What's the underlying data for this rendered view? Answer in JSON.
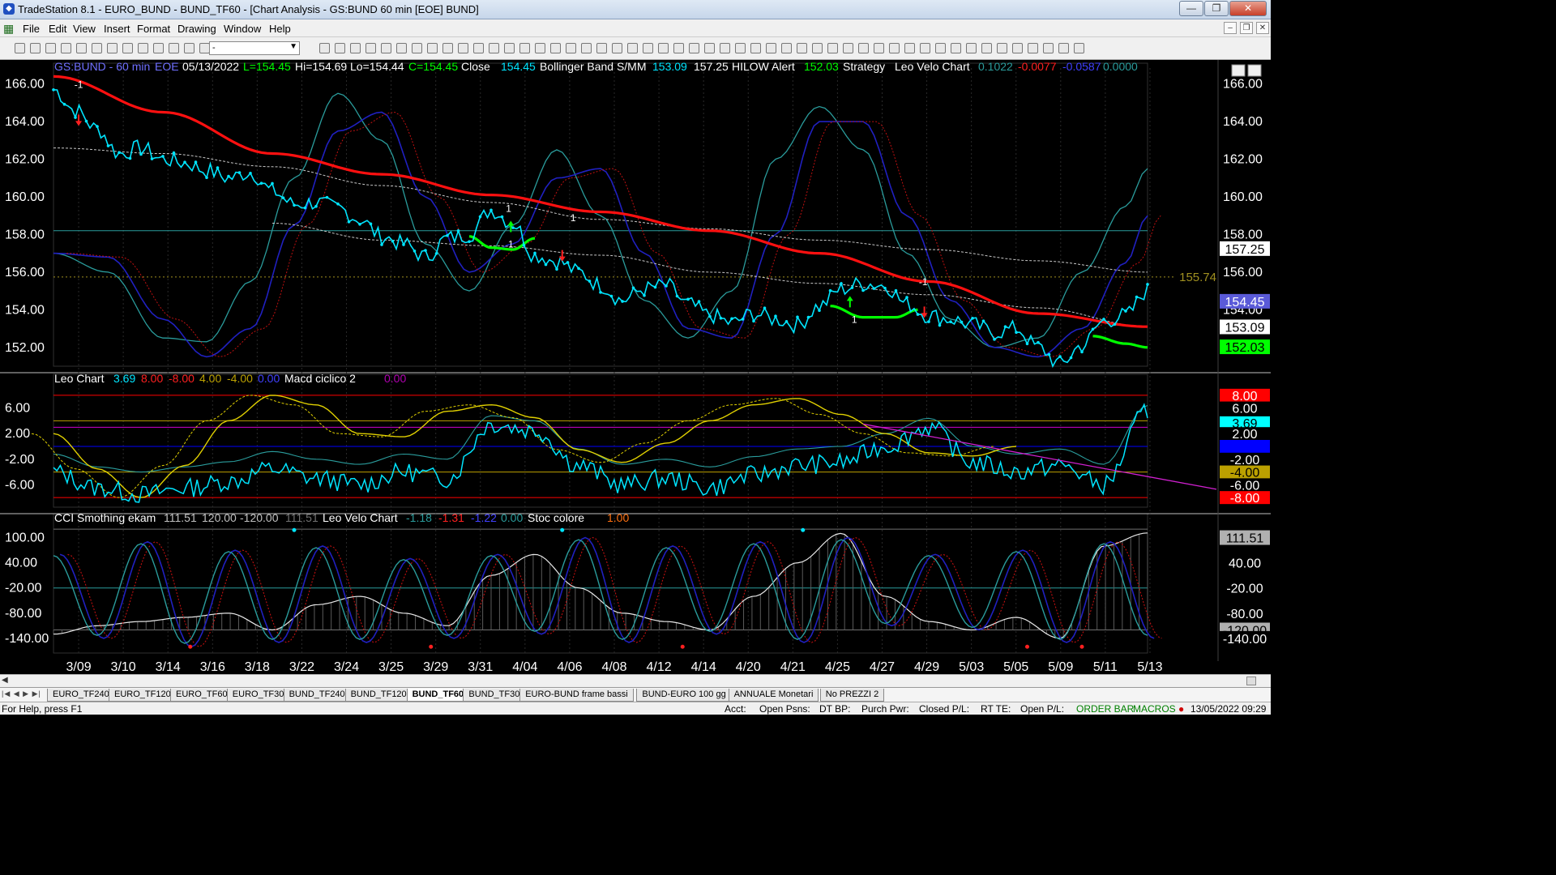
{
  "window": {
    "title": "TradeStation 8.1 - EURO_BUND - BUND_TF60 - [Chart Analysis - GS:BUND  60 min  [EOE] BUND]"
  },
  "menu": [
    "File",
    "Edit",
    "View",
    "Insert",
    "Format",
    "Drawing",
    "Window",
    "Help"
  ],
  "toolbar": {
    "combo_value": "-"
  },
  "chart_data": [
    {
      "type": "line",
      "panel": "price",
      "header": {
        "symbol": "GS:BUND - 60 min",
        "session": "EOE",
        "date": "05/13/2022",
        "last": "L=154.45",
        "high": "Hi=154.69",
        "low": "Lo=154.44",
        "close_c": "C=154.45",
        "close_label": "Close",
        "close_value": "154.45",
        "bb_label": "Bollinger Band S/MM",
        "bb_low": "153.09",
        "bb_high": "157.25",
        "hilow_label": "HILOW Alert",
        "hilow_value": "152.03",
        "strategy_label": "Strategy",
        "velo_label": "Leo Velo Chart",
        "velo_v1": "0.1022",
        "velo_v2": "-0.0077",
        "velo_v3": "-0.0587",
        "velo_v4": "0.0000"
      },
      "ylim": [
        151.0,
        166.5
      ],
      "y_ticks": [
        "166.00",
        "164.00",
        "162.00",
        "160.00",
        "158.00",
        "156.00",
        "154.00",
        "152.00"
      ],
      "right_labels": [
        {
          "text": "157.25",
          "value": 157.25,
          "bg": "#ffffff",
          "fg": "#000000"
        },
        {
          "text": "154.45",
          "value": 154.45,
          "bg": "#5a5ad8",
          "fg": "#ffffff"
        },
        {
          "text": "153.09",
          "value": 153.09,
          "bg": "#ffffff",
          "fg": "#000000"
        },
        {
          "text": "152.03",
          "value": 152.03,
          "bg": "#00ff00",
          "fg": "#000000"
        }
      ],
      "ref_line": {
        "text": "155.74",
        "value": 155.74,
        "color": "#a09020"
      },
      "hline": 158.2,
      "close_x": [
        0,
        2,
        4,
        6,
        8,
        10,
        12,
        14,
        16,
        18,
        20,
        22,
        24,
        26,
        28,
        30,
        32,
        34,
        36,
        38,
        40,
        42,
        44,
        46,
        48,
        50,
        52,
        54,
        56,
        58,
        60,
        62,
        64,
        66,
        68,
        70,
        72,
        74,
        76,
        78,
        80,
        82,
        84,
        86,
        88,
        90,
        92,
        94,
        96,
        98,
        100
      ],
      "close": [
        165.7,
        164.6,
        163.6,
        162.3,
        162.6,
        162.0,
        161.8,
        161.4,
        161.0,
        161.3,
        160.3,
        159.6,
        159.7,
        159.4,
        158.8,
        157.9,
        157.5,
        156.8,
        157.8,
        158.0,
        159.3,
        158.6,
        156.9,
        156.6,
        156.0,
        155.3,
        154.5,
        155.1,
        155.3,
        154.3,
        153.7,
        153.3,
        153.8,
        153.5,
        153.2,
        154.2,
        155.1,
        155.4,
        155.3,
        154.3,
        153.7,
        153.5,
        153.2,
        152.8,
        153.0,
        152.0,
        151.1,
        152.1,
        153.4,
        153.7,
        155.0
      ],
      "sma_x": [
        0,
        10,
        20,
        30,
        40,
        50,
        60,
        70,
        80,
        90,
        100
      ],
      "sma": [
        166.4,
        164.5,
        162.3,
        161.2,
        160.1,
        159.2,
        158.2,
        157.0,
        155.5,
        153.8,
        153.1
      ],
      "bb_upper": [
        162.6,
        162.3,
        161.6,
        160.6,
        159.7,
        158.8,
        158.3,
        157.7,
        157.2,
        156.6,
        156.0
      ],
      "bb_upper_tail": [
        162.3,
        161.9,
        161.1,
        160.2,
        159.3,
        158.7,
        157.8,
        157.2
      ],
      "bb_lower_x": [
        20,
        30,
        40,
        50,
        60,
        70,
        80,
        90,
        100
      ],
      "bb_lower": [
        158.6,
        157.7,
        157.4,
        156.9,
        156.0,
        155.4,
        154.8,
        154.1,
        153.1
      ],
      "osc_x": [
        0,
        5,
        10,
        14,
        18,
        22,
        26,
        30,
        34,
        38,
        42,
        46,
        50,
        54,
        58,
        62,
        66,
        70,
        74,
        78,
        82,
        86,
        90,
        94,
        98,
        100
      ],
      "osc_teal": [
        157.0,
        156.0,
        152.5,
        152.3,
        155.5,
        161.0,
        165.5,
        163.0,
        157.5,
        155.0,
        158.5,
        162.5,
        159.0,
        154.5,
        152.5,
        155.0,
        162.0,
        164.8,
        162.5,
        157.0,
        153.5,
        152.0,
        152.5,
        156.0,
        159.5,
        161.5
      ],
      "osc_blue": [
        157.0,
        156.8,
        153.5,
        151.5,
        153.0,
        158.5,
        163.5,
        164.5,
        160.0,
        156.0,
        157.5,
        161.0,
        161.5,
        157.0,
        153.0,
        152.5,
        158.0,
        164.0,
        164.0,
        159.0,
        154.5,
        152.0,
        151.5,
        153.0,
        156.5,
        159.0
      ]
    },
    {
      "type": "line",
      "panel": "leo_chart",
      "header": {
        "title": "Leo Chart",
        "v1": "3.69",
        "v2": "8.00",
        "v3": "-8.00",
        "v4": "4.00",
        "v5": "-4.00",
        "v6": "0.00",
        "macd_label": "Macd ciclico 2",
        "macd_value": "0.00"
      },
      "ylim": [
        -9.5,
        9.5
      ],
      "y_ticks": [
        "6.00",
        "2.00",
        "-2.00",
        "-6.00"
      ],
      "right_labels": [
        {
          "text": "8.00",
          "value": 8.0,
          "bg": "#ff0000",
          "fg": "#ffffff"
        },
        {
          "text": "6.00",
          "value": 6.0,
          "bg": "#000000",
          "fg": "#ffffff"
        },
        {
          "text": "3.69",
          "value": 3.69,
          "bg": "#00ffff",
          "fg": "#000000"
        },
        {
          "text": "2.00",
          "value": 2.0,
          "bg": "#000000",
          "fg": "#ffffff"
        },
        {
          "text": "0.00",
          "value": 0.0,
          "bg": "#0000ff",
          "fg": "#0000ff"
        },
        {
          "text": "-2.00",
          "value": -2.0,
          "bg": "#000000",
          "fg": "#ffffff"
        },
        {
          "text": "-4.00",
          "value": -4.0,
          "bg": "#bba000",
          "fg": "#000000"
        },
        {
          "text": "-6.00",
          "value": -6.0,
          "bg": "#000000",
          "fg": "#ffffff"
        },
        {
          "text": "-8.00",
          "value": -8.0,
          "bg": "#ff0000",
          "fg": "#ffffff"
        }
      ],
      "levels": [
        {
          "value": 8.0,
          "color": "#ff0000"
        },
        {
          "value": 4.0,
          "color": "#bba000"
        },
        {
          "value": 3.0,
          "color": "#cc00cc"
        },
        {
          "value": 0.0,
          "color": "#0000ff"
        },
        {
          "value": -4.0,
          "color": "#bba000"
        },
        {
          "value": -8.0,
          "color": "#ff0000"
        }
      ],
      "x": [
        0,
        4,
        8,
        12,
        16,
        20,
        24,
        28,
        32,
        36,
        40,
        44,
        48,
        52,
        56,
        60,
        64,
        68,
        72,
        76,
        80,
        84,
        88,
        92,
        96,
        100
      ],
      "leo": [
        -4.0,
        -6.5,
        -7.5,
        -6.5,
        -5.5,
        -3.5,
        -5.0,
        -6.0,
        -4.0,
        -5.0,
        3.5,
        2.5,
        -3.0,
        -6.0,
        -5.0,
        -6.5,
        -4.5,
        -3.0,
        -2.5,
        0.0,
        3.0,
        -2.5,
        -4.0,
        -3.0,
        -6.0,
        5.5
      ],
      "yellow": [
        2.0,
        -3.5,
        -8.0,
        -3.0,
        4.0,
        8.0,
        6.5,
        2.0,
        1.5,
        5.5,
        6.5,
        4.5,
        -0.5,
        -2.5,
        0.5,
        4.0,
        6.5,
        7.5,
        5.0,
        2.0,
        -1.0,
        -1.5,
        0.0
      ],
      "yellow_x": [
        0,
        4,
        8,
        12,
        16,
        20,
        24,
        28,
        32,
        36,
        40,
        44,
        48,
        52,
        56,
        60,
        64,
        68,
        72,
        76,
        80,
        84,
        88
      ],
      "trend_x": [
        74,
        100
      ],
      "trend": [
        3.5,
        -5.5
      ]
    },
    {
      "type": "line",
      "panel": "cci",
      "header": {
        "title": "CCI Smothing ekam",
        "v1": "111.51",
        "v2": "120.00",
        "v3": "-120.00",
        "v4": "111.51",
        "velo_label": "Leo Velo Chart",
        "velo_v1": "-1.18",
        "velo_v2": "-1.31",
        "velo_v3": "-1.22",
        "velo_v4": "0.00",
        "stoc_label": "Stoc colore",
        "stoc_value": "1.00"
      },
      "ylim": [
        -175,
        130
      ],
      "y_ticks": [
        "100.00",
        "40.00",
        "-20.00",
        "-80.00",
        "-140.00"
      ],
      "right_labels": [
        {
          "text": "111.51",
          "value": 100.0,
          "bg": "#b0b0b0",
          "fg": "#000000"
        },
        {
          "text": "40.00",
          "value": 40.0,
          "bg": "#000000",
          "fg": "#ffffff"
        },
        {
          "text": "-20.00",
          "value": -20.0,
          "bg": "#000000",
          "fg": "#ffffff"
        },
        {
          "text": "-80.00",
          "value": -80.0,
          "bg": "#000000",
          "fg": "#ffffff"
        },
        {
          "text": "-120.00",
          "value": -120.0,
          "bg": "#b0b0b0",
          "fg": "#000000"
        },
        {
          "text": "-140.00",
          "value": -140.0,
          "bg": "#000000",
          "fg": "#ffffff"
        }
      ],
      "x": [
        0,
        4,
        8,
        12,
        16,
        20,
        24,
        28,
        32,
        36,
        40,
        44,
        48,
        52,
        56,
        60,
        64,
        68,
        72,
        76,
        80,
        84,
        88,
        92,
        96,
        100
      ],
      "cci": [
        60,
        -140,
        90,
        -160,
        70,
        -150,
        80,
        -150,
        50,
        -140,
        60,
        -130,
        100,
        -150,
        80,
        -130,
        90,
        -150,
        100,
        -110,
        60,
        -120,
        70,
        -150,
        90,
        -140
      ],
      "white": [
        -130,
        -110,
        -100,
        -90,
        -80,
        -120,
        -60,
        -40,
        -80,
        -110,
        10,
        60,
        -20,
        -80,
        -100,
        -120,
        -40,
        40,
        110,
        -40,
        -100,
        -120,
        -90,
        -140,
        80,
        111
      ]
    }
  ],
  "time_axis": [
    "3/09",
    "3/10",
    "3/14",
    "3/16",
    "3/18",
    "3/22",
    "3/24",
    "3/25",
    "3/29",
    "3/31",
    "4/04",
    "4/06",
    "4/08",
    "4/12",
    "4/14",
    "4/20",
    "4/21",
    "4/25",
    "4/27",
    "4/29",
    "5/03",
    "5/05",
    "5/09",
    "5/11",
    "5/13"
  ],
  "annotations": [
    "-1",
    "1",
    "1",
    "1",
    "-1",
    "1"
  ],
  "tabs": [
    "EURO_TF240",
    "EURO_TF120",
    "EURO_TF60",
    "EURO_TF30",
    "BUND_TF240",
    "BUND_TF120",
    "BUND_TF60",
    "BUND_TF30",
    "EURO-BUND frame bassi",
    "BUND-EURO 100 gg",
    "ANNUALE Monetari",
    "No PREZZI 2"
  ],
  "active_tab": "BUND_TF60",
  "status": {
    "help": "For Help, press F1",
    "acct": "Acct:",
    "open_psns": "Open Psns:",
    "dt_bp": "DT BP:",
    "purch_pwr": "Purch Pwr:",
    "closed_pl": "Closed P/L:",
    "rt_te": "RT TE:",
    "open_pl": "Open P/L:",
    "order_bar": "ORDER BAR",
    "macros": "MACROS",
    "datetime": "13/05/2022 09:29"
  },
  "colors": {
    "teal": "#2a9c9c",
    "blue": "#2020c0",
    "red": "#ff1010",
    "green": "#00ff00",
    "cyan": "#00e5ff",
    "yellow": "#e0d000",
    "magenta": "#d020d0",
    "gray": "#c0c0c0"
  }
}
